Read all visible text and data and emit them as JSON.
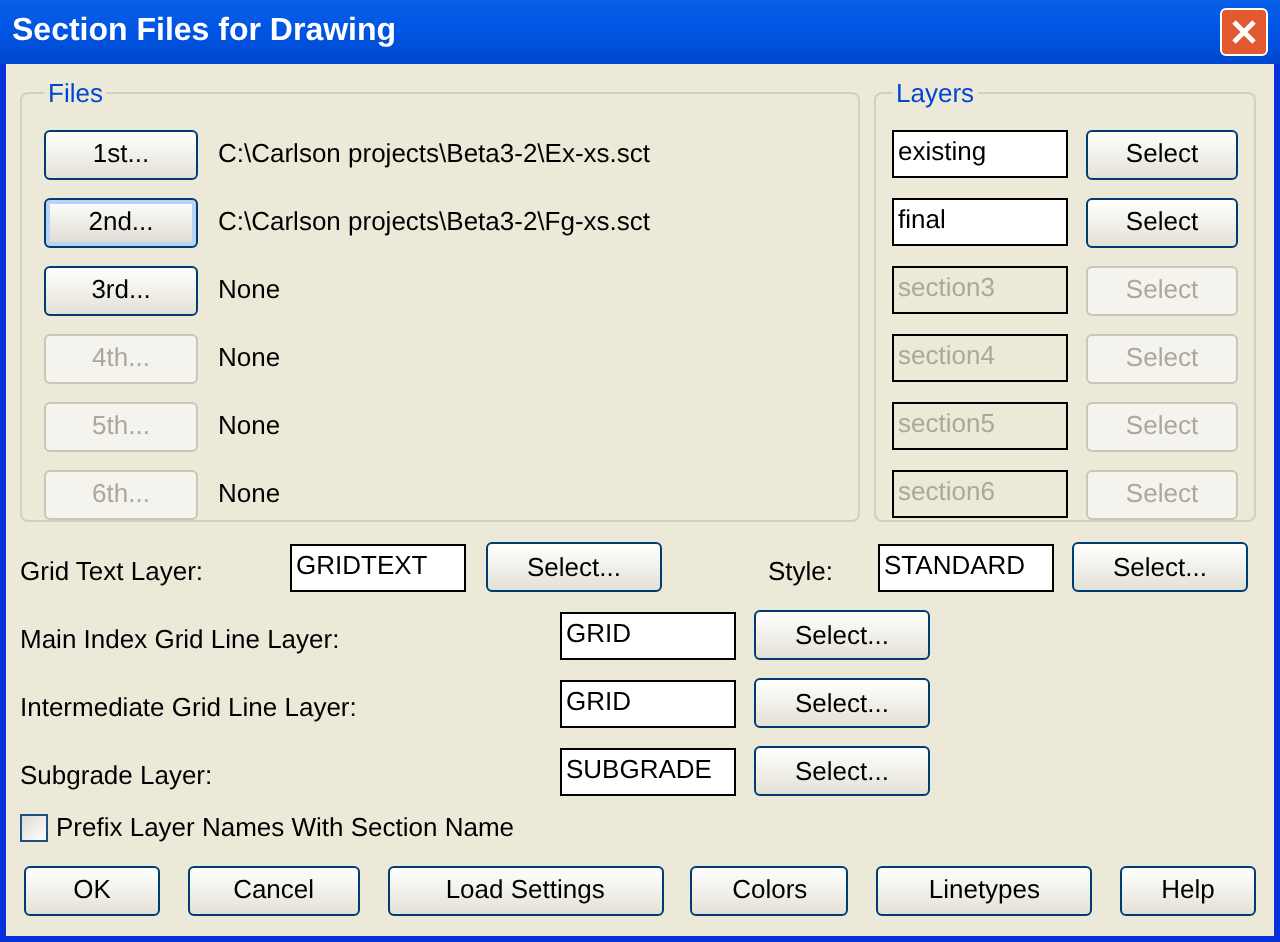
{
  "window": {
    "title": "Section Files for Drawing"
  },
  "files_group": {
    "title": "Files",
    "rows": [
      {
        "button": "1st...",
        "path": "C:\\Carlson projects\\Beta3-2\\Ex-xs.sct",
        "disabled": false,
        "focused": false
      },
      {
        "button": "2nd...",
        "path": "C:\\Carlson projects\\Beta3-2\\Fg-xs.sct",
        "disabled": false,
        "focused": true
      },
      {
        "button": "3rd...",
        "path": "None",
        "disabled": false,
        "focused": false
      },
      {
        "button": "4th...",
        "path": "None",
        "disabled": true,
        "focused": false
      },
      {
        "button": "5th...",
        "path": "None",
        "disabled": true,
        "focused": false
      },
      {
        "button": "6th...",
        "path": "None",
        "disabled": true,
        "focused": false
      }
    ]
  },
  "layers_group": {
    "title": "Layers",
    "rows": [
      {
        "value": "existing",
        "button": "Select",
        "disabled": false
      },
      {
        "value": "final",
        "button": "Select",
        "disabled": false
      },
      {
        "value": "section3",
        "button": "Select",
        "disabled": true
      },
      {
        "value": "section4",
        "button": "Select",
        "disabled": true
      },
      {
        "value": "section5",
        "button": "Select",
        "disabled": true
      },
      {
        "value": "section6",
        "button": "Select",
        "disabled": true
      }
    ]
  },
  "grid_text": {
    "label": "Grid Text Layer:",
    "value": "GRIDTEXT",
    "button": "Select..."
  },
  "style": {
    "label": "Style:",
    "value": "STANDARD",
    "button": "Select..."
  },
  "layer_rows": [
    {
      "label": "Main Index Grid Line Layer:",
      "value": "GRID",
      "button": "Select..."
    },
    {
      "label": "Intermediate Grid Line Layer:",
      "value": "GRID",
      "button": "Select..."
    },
    {
      "label": "Subgrade Layer:",
      "value": "SUBGRADE",
      "button": "Select..."
    }
  ],
  "prefix_checkbox": {
    "label": "Prefix Layer Names With Section Name",
    "checked": false
  },
  "buttons": [
    "OK",
    "Cancel",
    "Load Settings",
    "Colors",
    "Linetypes",
    "Help"
  ]
}
